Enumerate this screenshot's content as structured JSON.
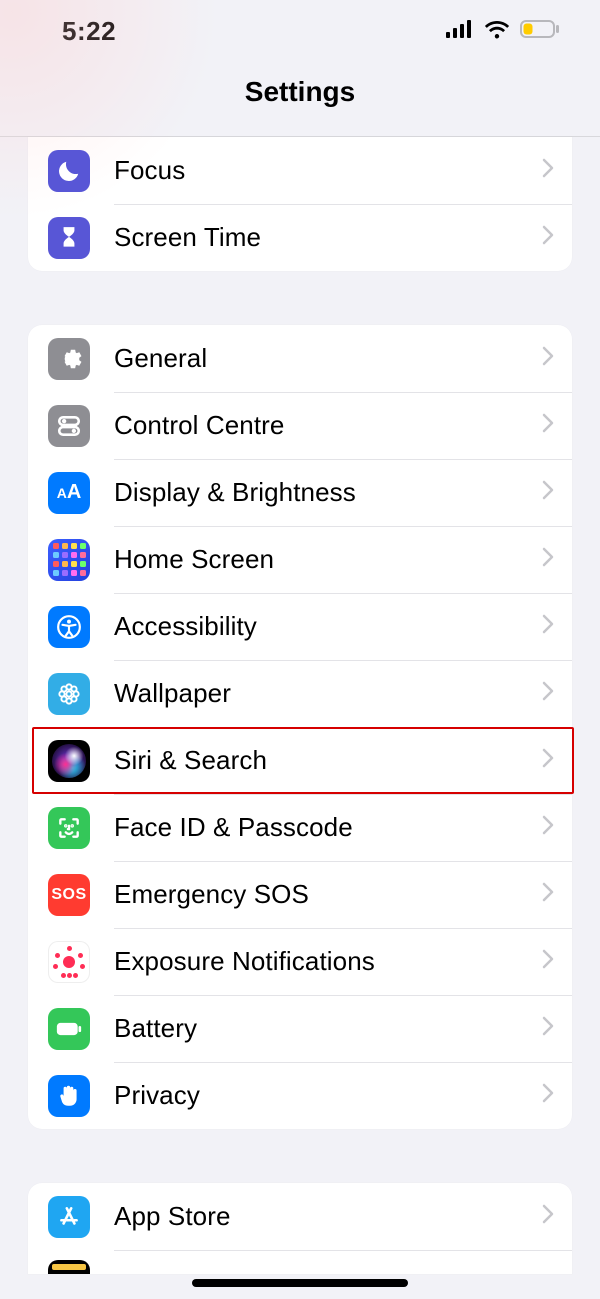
{
  "status": {
    "time": "5:22"
  },
  "header": {
    "title": "Settings"
  },
  "groups": [
    {
      "items": [
        {
          "id": "focus",
          "label": "Focus"
        },
        {
          "id": "screen-time",
          "label": "Screen Time"
        }
      ]
    },
    {
      "items": [
        {
          "id": "general",
          "label": "General"
        },
        {
          "id": "control-centre",
          "label": "Control Centre"
        },
        {
          "id": "display-brightness",
          "label": "Display & Brightness"
        },
        {
          "id": "home-screen",
          "label": "Home Screen"
        },
        {
          "id": "accessibility",
          "label": "Accessibility"
        },
        {
          "id": "wallpaper",
          "label": "Wallpaper"
        },
        {
          "id": "siri-search",
          "label": "Siri & Search",
          "highlighted": true
        },
        {
          "id": "face-id-passcode",
          "label": "Face ID & Passcode"
        },
        {
          "id": "emergency-sos",
          "label": "Emergency SOS"
        },
        {
          "id": "exposure-notifications",
          "label": "Exposure Notifications"
        },
        {
          "id": "battery",
          "label": "Battery"
        },
        {
          "id": "privacy",
          "label": "Privacy"
        }
      ]
    },
    {
      "items": [
        {
          "id": "app-store",
          "label": "App Store"
        },
        {
          "id": "wallet",
          "label": ""
        }
      ]
    }
  ],
  "colors": {
    "highlight": "#d60000",
    "chevron": "#c6c6cb"
  }
}
